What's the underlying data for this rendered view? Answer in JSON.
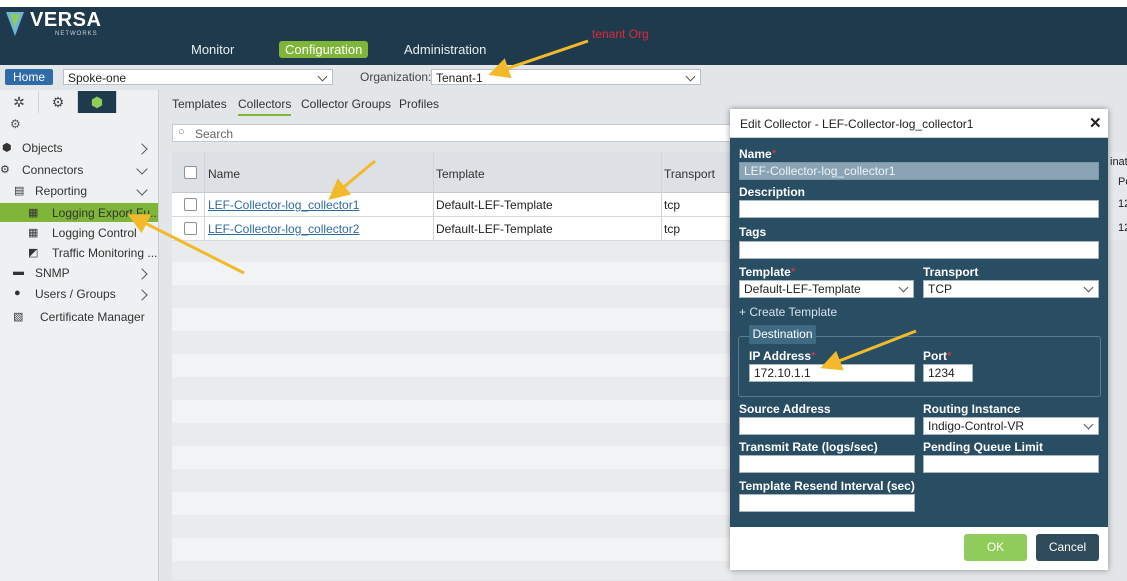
{
  "header": {
    "logo_text": "VERSA",
    "logo_sub": "NETWORKS",
    "nav": [
      "Monitor",
      "Configuration",
      "Administration"
    ],
    "annotation": "tenant Org"
  },
  "context": {
    "home_label": "Home",
    "appliance_value": "Spoke-one",
    "org_label": "Organization:",
    "org_value": "Tenant-1"
  },
  "sidebar": {
    "tab_icons": [
      "asterisk-icon",
      "gear-icon",
      "cube-icon"
    ],
    "items": [
      {
        "label": "Objects"
      },
      {
        "label": "Connectors"
      },
      {
        "label": "Reporting"
      },
      {
        "label": "Logging Export Fu..."
      },
      {
        "label": "Logging Control"
      },
      {
        "label": "Traffic Monitoring ..."
      },
      {
        "label": "SNMP"
      },
      {
        "label": "Users / Groups"
      },
      {
        "label": "Certificate Manager"
      }
    ]
  },
  "main": {
    "tabs": [
      "Templates",
      "Collectors",
      "Collector Groups",
      "Profiles"
    ],
    "active_tab": "Collectors",
    "search_placeholder": "Search",
    "columns": [
      "Name",
      "Template",
      "Transport"
    ],
    "rows": [
      {
        "name": "LEF-Collector-log_collector1",
        "template": "Default-LEF-Template",
        "transport": "tcp",
        "peek": "12"
      },
      {
        "name": "LEF-Collector-log_collector2",
        "template": "Default-LEF-Template",
        "transport": "tcp",
        "peek": "12"
      }
    ],
    "peek_header_1": "inat",
    "peek_header_2": "Po"
  },
  "modal": {
    "title": "Edit Collector - LEF-Collector-log_collector1",
    "close": "✕",
    "name_label": "Name",
    "name_value": "LEF-Collector-log_collector1",
    "description_label": "Description",
    "description_value": "",
    "tags_label": "Tags",
    "tags_value": "",
    "template_label": "Template",
    "template_value": "Default-LEF-Template",
    "transport_label": "Transport",
    "transport_value": "TCP",
    "create_template": "+ Create Template",
    "destination_label": "Destination",
    "ip_label": "IP Address",
    "ip_value": "172.10.1.1",
    "port_label": "Port",
    "port_value": "1234",
    "source_label": "Source Address",
    "source_value": "",
    "routing_label": "Routing Instance",
    "routing_value": "Indigo-Control-VR",
    "rate_label": "Transmit Rate (logs/sec)",
    "rate_value": "",
    "queue_label": "Pending Queue Limit",
    "queue_value": "",
    "resend_label": "Template Resend Interval (sec)",
    "resend_value": "",
    "required_mark": "*",
    "ok_label": "OK",
    "cancel_label": "Cancel"
  },
  "colors": {
    "header_bg": "#1f3a4d",
    "accent_green": "#7fb63a",
    "link_blue": "#2d6ba3",
    "modal_bg": "#294d62",
    "annotation_arrow": "#f2b92a",
    "annotation_text": "#e0283a"
  }
}
